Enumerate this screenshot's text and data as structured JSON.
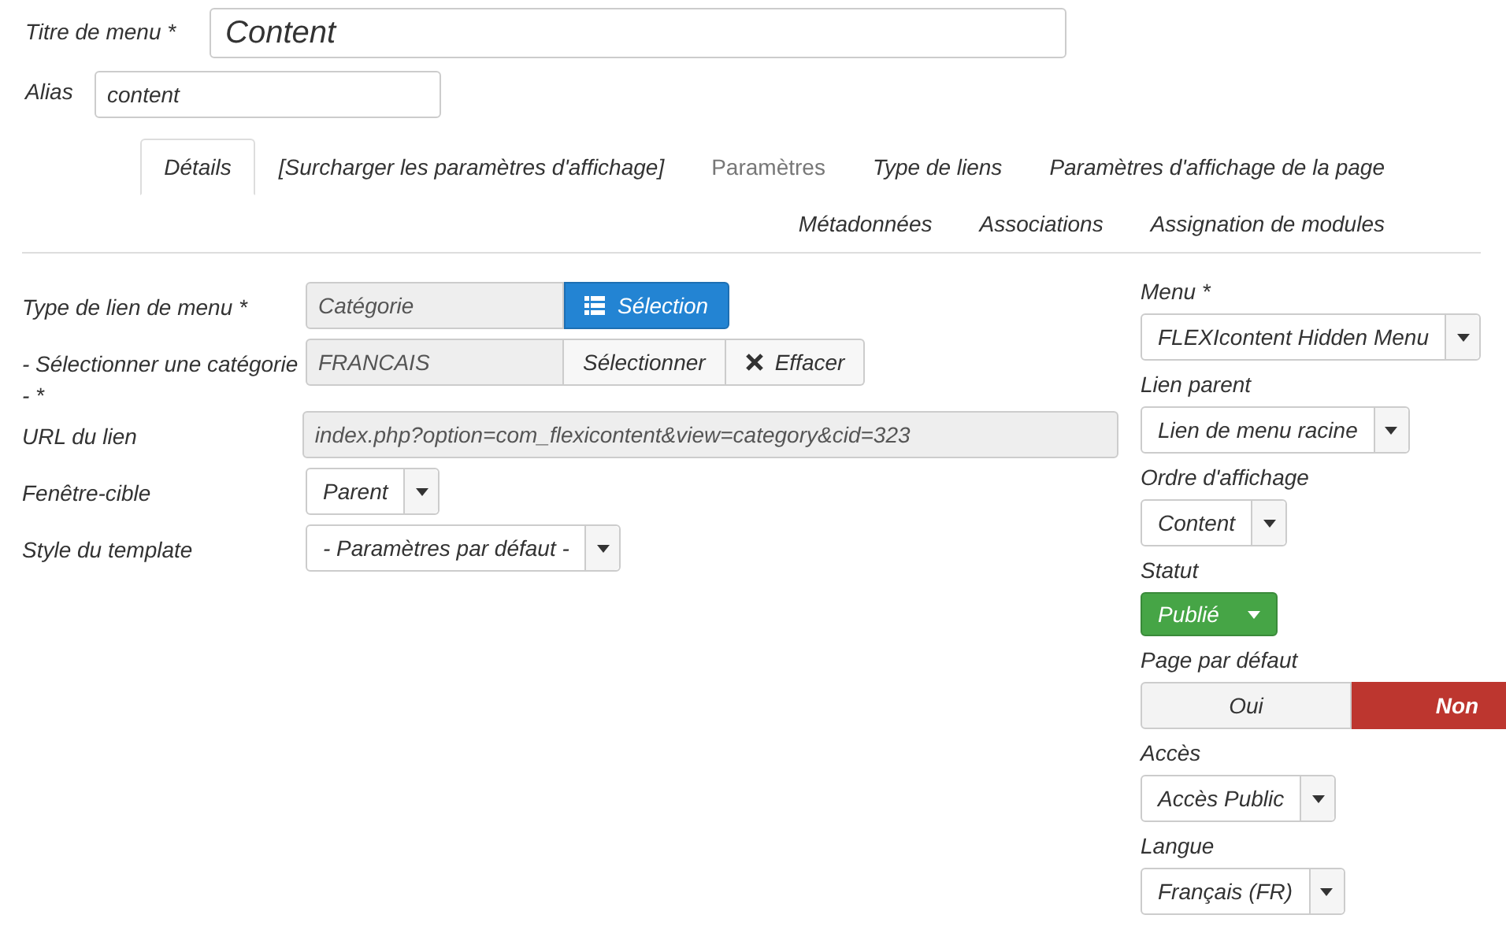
{
  "title_field": {
    "label": "Titre de menu *",
    "value": "Content"
  },
  "alias_field": {
    "label": "Alias",
    "value": "content"
  },
  "tabs": [
    {
      "label": "Détails",
      "selected": true,
      "disabled": false
    },
    {
      "label": "[Surcharger les paramètres d'affichage]",
      "selected": false,
      "disabled": false
    },
    {
      "label": "Paramètres",
      "selected": false,
      "disabled": true
    },
    {
      "label": "Type de liens",
      "selected": false,
      "disabled": false
    },
    {
      "label": "Paramètres d'affichage de la page",
      "selected": false,
      "disabled": false
    },
    {
      "label": "Métadonnées",
      "selected": false,
      "disabled": false
    },
    {
      "label": "Associations",
      "selected": false,
      "disabled": false
    },
    {
      "label": "Assignation de modules",
      "selected": false,
      "disabled": false
    }
  ],
  "details": [
    {
      "kind": "picker",
      "label": "Type de lien de menu *",
      "value": "Catégorie",
      "buttons": [
        {
          "label": "Sélection",
          "kind": "primary"
        }
      ]
    },
    {
      "kind": "picker",
      "label": "- Sélectionner une catégorie -  *",
      "value": "FRANCAIS",
      "buttons": [
        {
          "label": "Sélectionner",
          "kind": "plain"
        },
        {
          "label": "Effacer",
          "kind": "clear"
        }
      ]
    },
    {
      "kind": "readonly",
      "label": "URL du lien",
      "value": "index.php?option=com_flexicontent&view=category&cid=323"
    },
    {
      "kind": "select",
      "label": "Fenêtre-cible",
      "value": "Parent"
    },
    {
      "kind": "select",
      "label": "Style du template",
      "value": "- Paramètres par défaut -"
    }
  ],
  "sidebar": [
    {
      "kind": "select",
      "label": "Menu *",
      "value": "FLEXIcontent Hidden Menu"
    },
    {
      "kind": "select",
      "label": "Lien parent",
      "value": "Lien de menu racine"
    },
    {
      "kind": "select",
      "label": "Ordre d'affichage",
      "value": "Content"
    },
    {
      "kind": "status",
      "label": "Statut",
      "value": "Publié"
    },
    {
      "kind": "toggle",
      "label": "Page par défaut",
      "options": [
        {
          "label": "Oui",
          "selected": false
        },
        {
          "label": "Non",
          "selected": true
        }
      ]
    },
    {
      "kind": "select",
      "label": "Accès",
      "value": "Accès Public"
    },
    {
      "kind": "select",
      "label": "Langue",
      "value": "Français (FR)"
    }
  ]
}
